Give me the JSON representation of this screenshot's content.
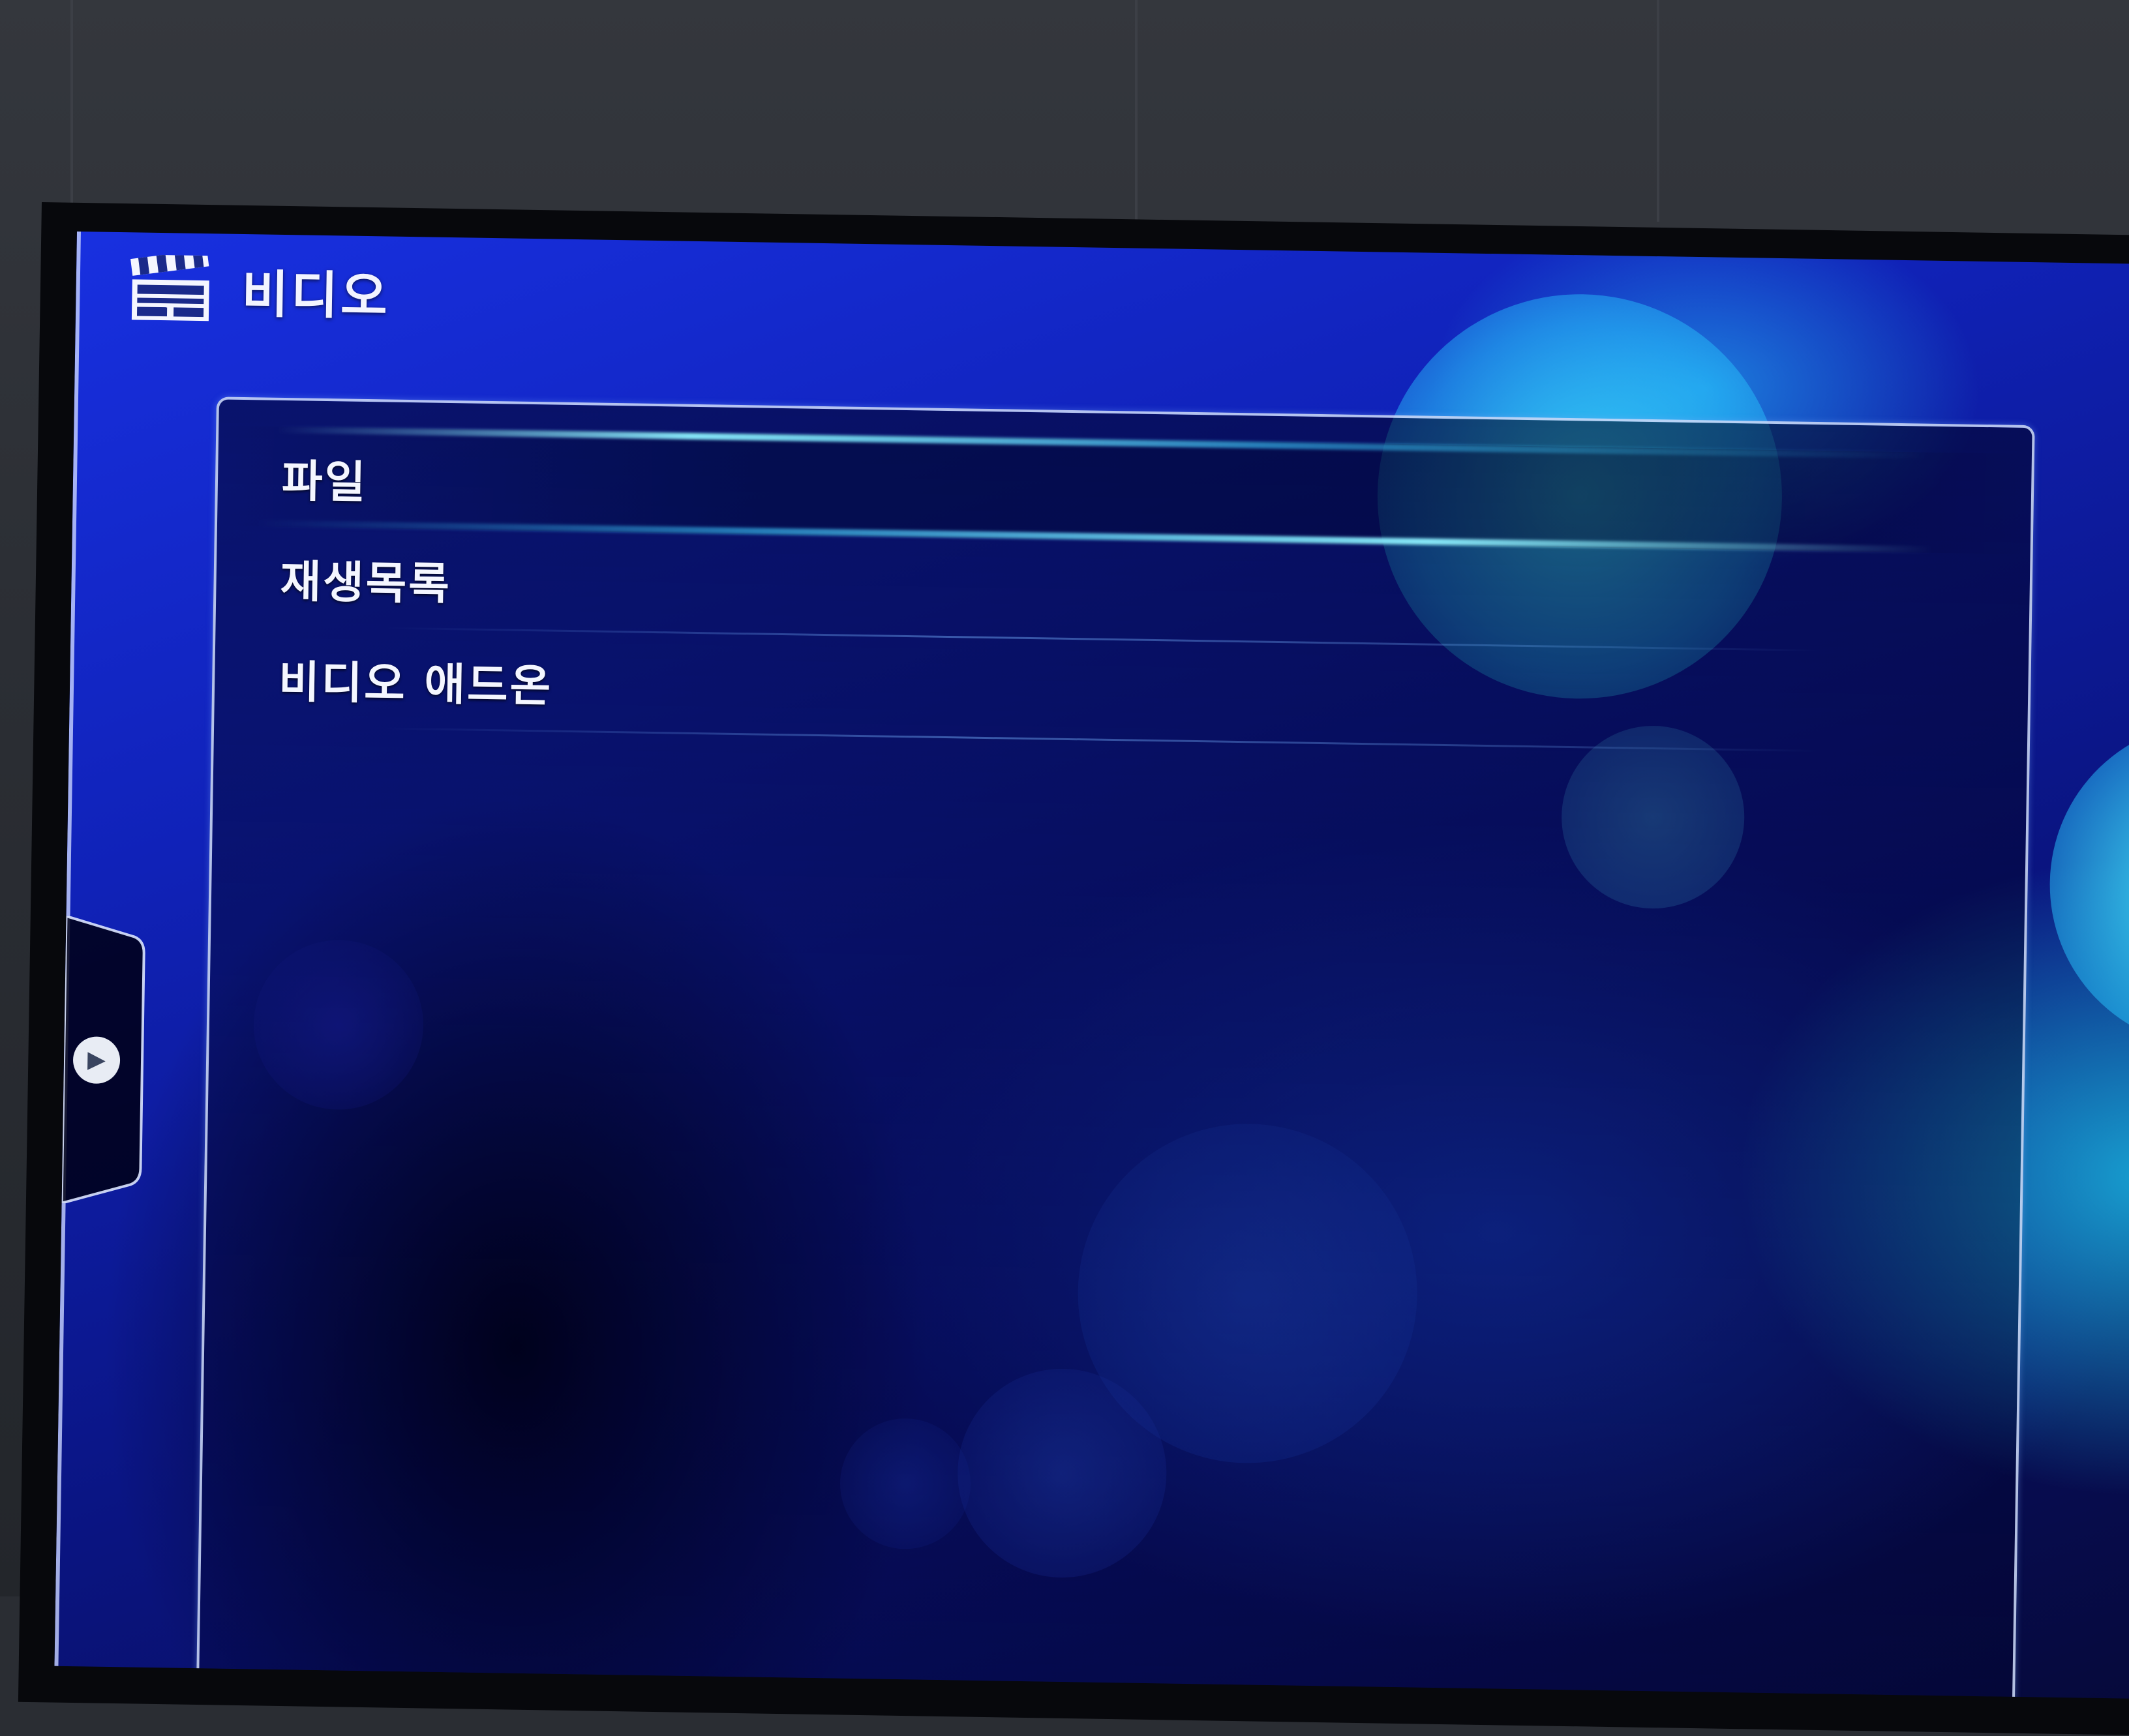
{
  "header": {
    "icon": "clapperboard-icon",
    "title": "비디오"
  },
  "menu": {
    "items": [
      {
        "label": "파일",
        "focused": true
      },
      {
        "label": "재생목록",
        "focused": false
      },
      {
        "label": "비디오 애드온",
        "focused": false
      }
    ]
  },
  "side_tab": {
    "icon": "play-arrow-icon",
    "glyph": "▶"
  },
  "colors": {
    "background_primary": "#1022b8",
    "accent_glow": "#8cf0ff",
    "text": "#f4f6ff"
  }
}
